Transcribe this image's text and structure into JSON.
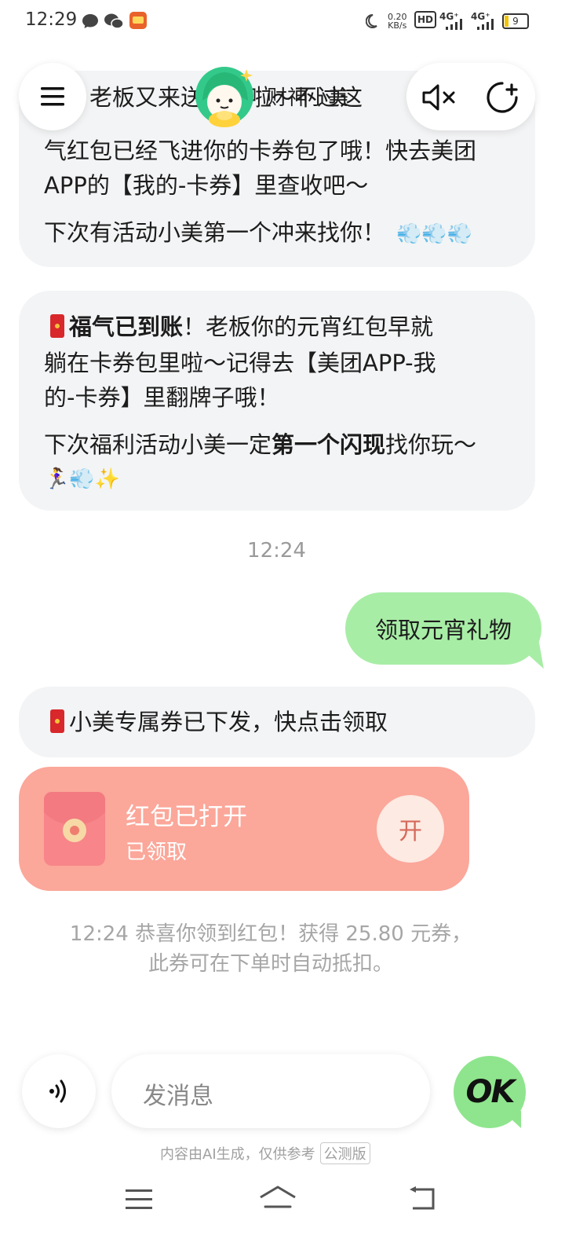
{
  "status_bar": {
    "time": "12:29",
    "net_speed_value": "0.20",
    "net_speed_unit": "KB/s",
    "hd_label": "HD",
    "sim1_label": "4G⁺",
    "sim2_label": "4G⁺",
    "battery": "9",
    "icons": [
      "message-icon",
      "wechat-icon",
      "app-icon",
      "moon-icon",
      "hd-icon",
      "signal-icon",
      "battery-icon"
    ]
  },
  "header": {
    "title": "财神小美",
    "icons": [
      "menu-icon",
      "avatar",
      "mute-icon",
      "new-chat-icon"
    ]
  },
  "chat": {
    "bubble1": {
      "line1": "哇！老板又来送祝福啦～不过这",
      "line2": "气红包已经飞进你的卡券包了哦！快去美团",
      "line3": "APP的【我的-卡券】里查收吧～",
      "line4": "下次有活动小美第一个冲来找你！",
      "emoji": "💨💨💨"
    },
    "bubble2": {
      "line1_bold": "福气已到账",
      "line1_rest": "！老板你的元宵红包早就",
      "line2": "躺在卡券包里啦～记得去【美团APP-我",
      "line3": "的-卡券】里翻牌子哦！",
      "line4_pre": "下次福利活动小美一定",
      "line4_bold": "第一个闪现",
      "line4_post": "找你玩～",
      "line5_emoji": "🏃‍♀️💨✨"
    },
    "timestamp": "12:24",
    "user_message": "领取元宵礼物",
    "coupon_message": "小美专属券已下发，快点击领取",
    "red_packet": {
      "title": "红包已打开",
      "subtitle": "已领取",
      "button": "开"
    },
    "system_line1": "12:24 恭喜你领到红包！获得 25.80 元券，",
    "system_line2": "此券可在下单时自动抵扣。"
  },
  "input": {
    "placeholder": "发消息",
    "ok_label": "OK"
  },
  "disclaimer": {
    "text": "内容由AI生成，仅供参考",
    "tag": "公测版"
  },
  "colors": {
    "user_bubble": "#a8eda6",
    "bot_bubble": "#f3f4f5",
    "red_packet": "#fba79a",
    "ok_button": "#8fe58d"
  }
}
